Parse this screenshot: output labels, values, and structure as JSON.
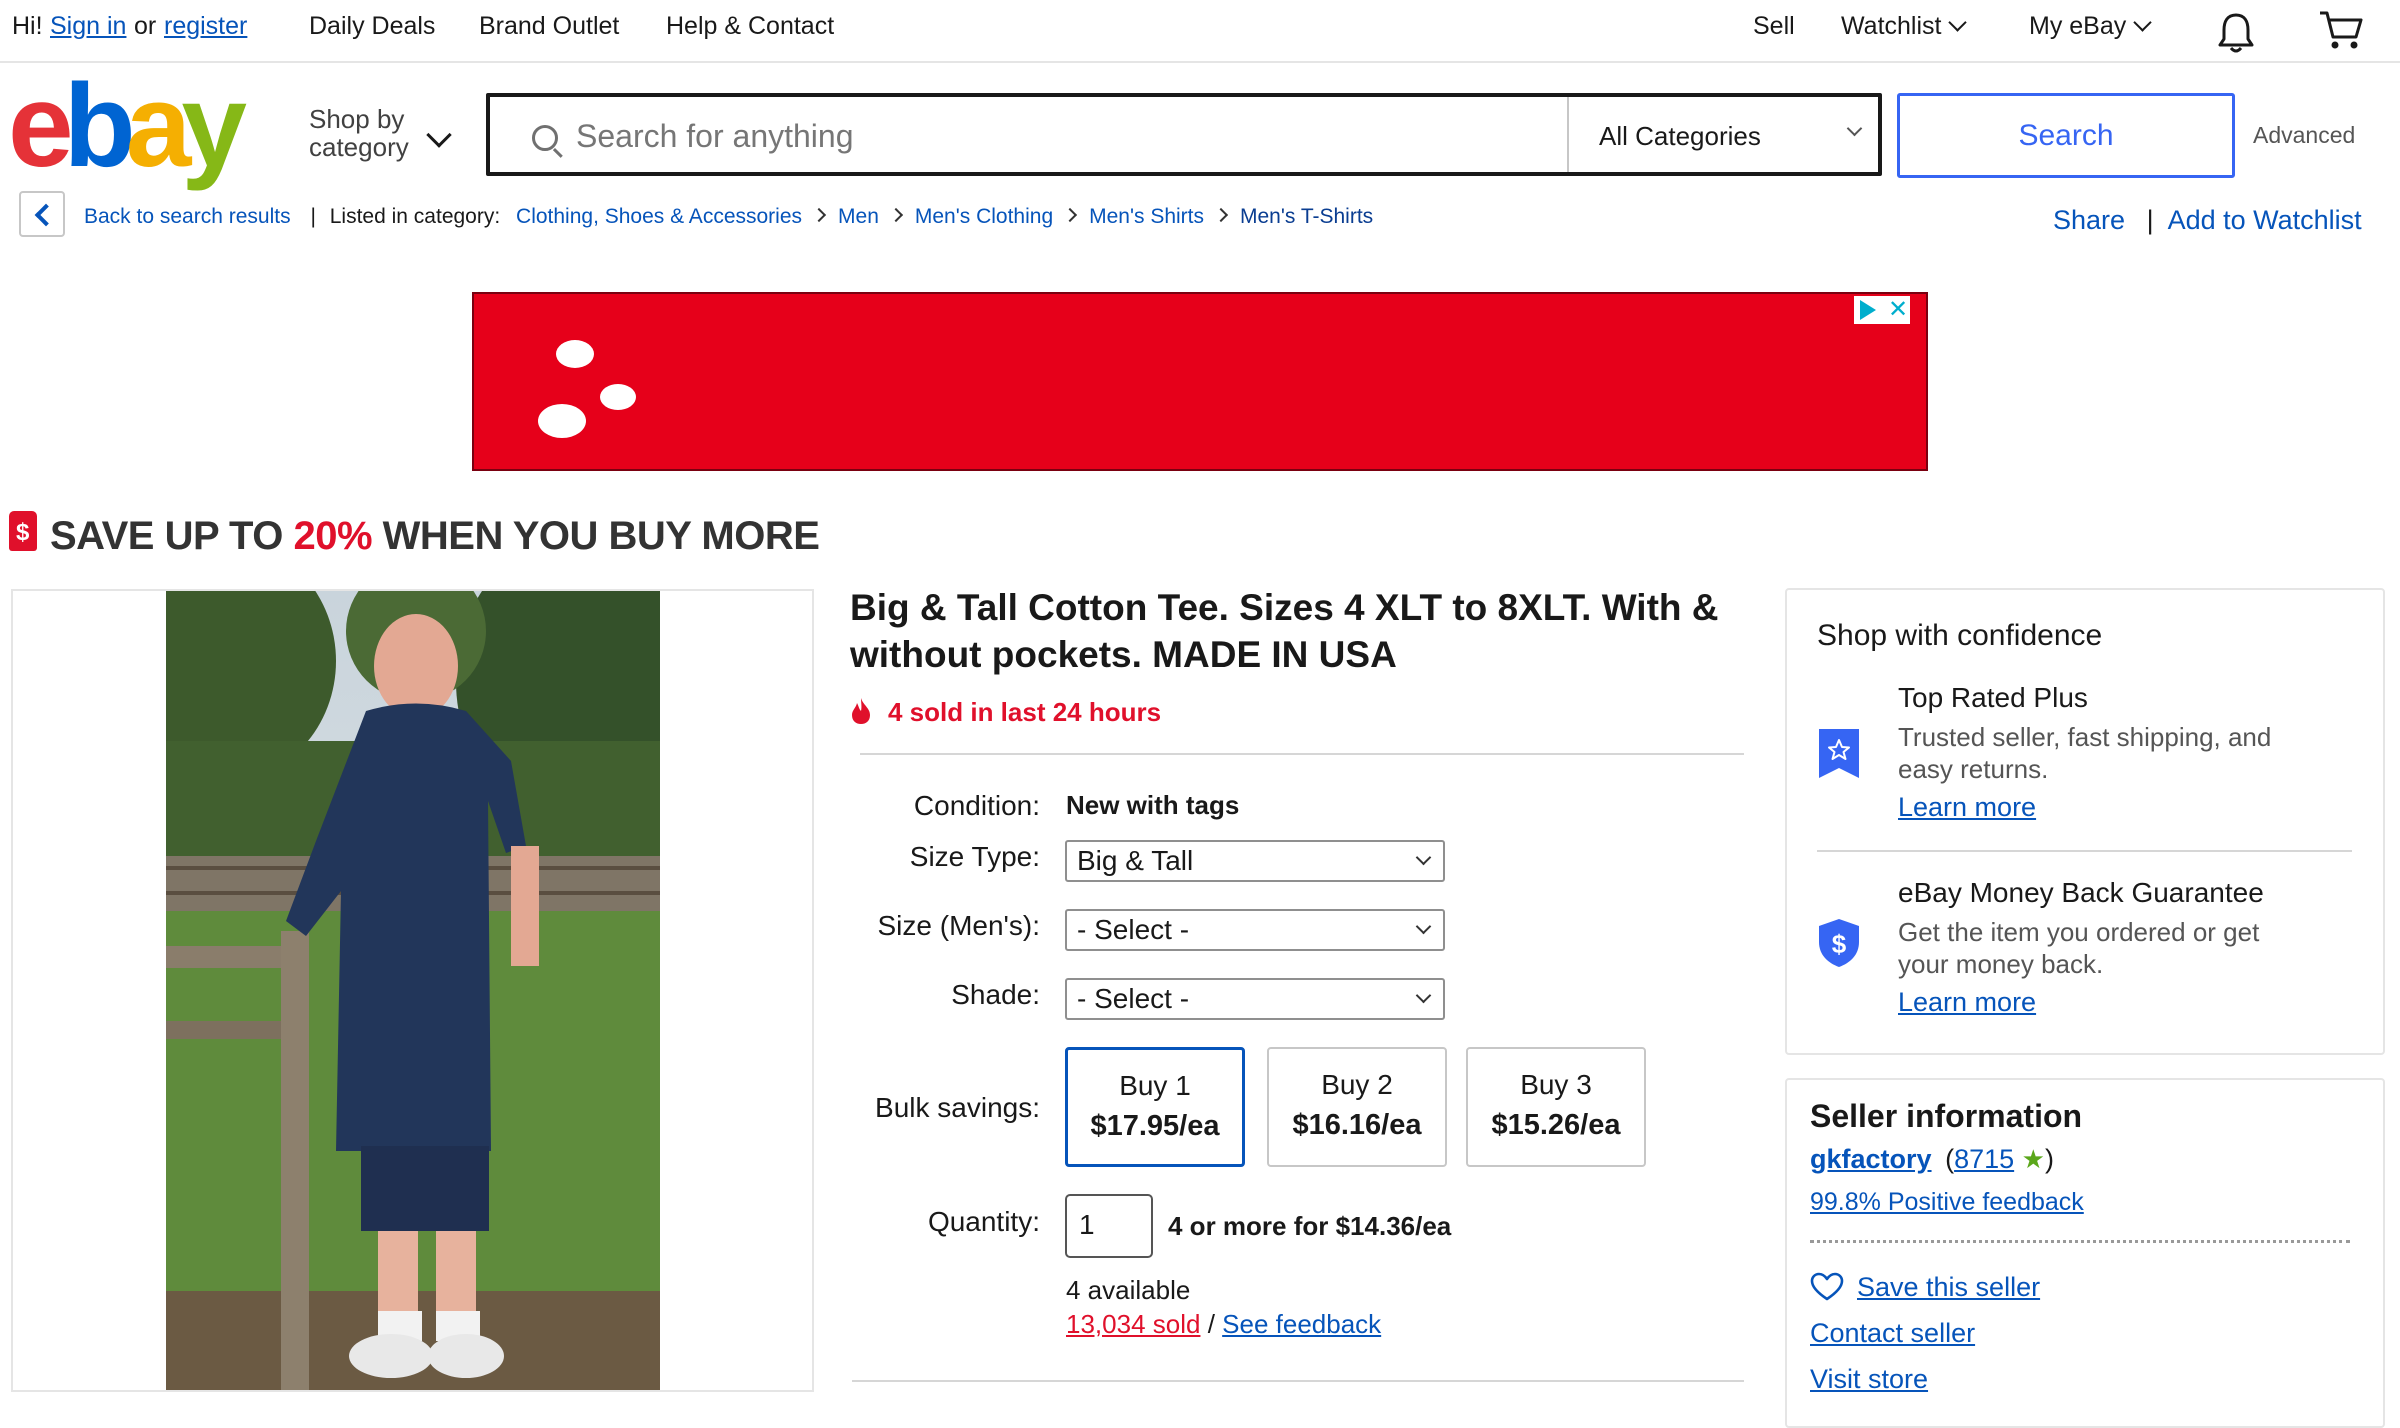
{
  "topbar": {
    "greeting": "Hi!",
    "sign_in": "Sign in",
    "or": "or",
    "register": "register",
    "daily_deals": "Daily Deals",
    "brand_outlet": "Brand Outlet",
    "help_contact": "Help & Contact",
    "sell": "Sell",
    "watchlist": "Watchlist",
    "my_ebay": "My eBay"
  },
  "header": {
    "logo_letters": [
      "e",
      "b",
      "a",
      "y"
    ],
    "logo_colors": [
      "#e53238",
      "#0064d2",
      "#f5af02",
      "#86b817"
    ],
    "shop_by_line1": "Shop by",
    "shop_by_line2": "category",
    "search_placeholder": "Search for anything",
    "category": "All Categories",
    "search_button": "Search",
    "advanced": "Advanced"
  },
  "breadcrumb": {
    "back": "Back to search results",
    "listed_in": "Listed in category:",
    "items": [
      "Clothing, Shoes & Accessories",
      "Men",
      "Men's Clothing",
      "Men's Shirts",
      "Men's T-Shirts"
    ],
    "share": "Share",
    "add_watchlist": "Add to Watchlist"
  },
  "promo": {
    "prefix": "SAVE UP TO ",
    "percent": "20%",
    "suffix": " WHEN YOU BUY MORE"
  },
  "product": {
    "title": "Big & Tall Cotton Tee. Sizes 4 XLT to 8XLT. With & without pockets. MADE IN USA",
    "sold_recent": "4 sold in last 24 hours",
    "condition_label": "Condition:",
    "condition_value": "New with tags",
    "size_type_label": "Size Type:",
    "size_type_value": "Big & Tall",
    "size_label": "Size (Men's):",
    "size_value": "- Select -",
    "shade_label": "Shade:",
    "shade_value": "- Select -",
    "bulk_label": "Bulk savings:",
    "bulk_options": [
      {
        "qty": "Buy 1",
        "price": "$17.95/ea"
      },
      {
        "qty": "Buy 2",
        "price": "$16.16/ea"
      },
      {
        "qty": "Buy 3",
        "price": "$15.26/ea"
      }
    ],
    "quantity_label": "Quantity:",
    "quantity_value": "1",
    "quantity_deal": "4 or more for $14.36/ea",
    "available": "4 available",
    "sold_total": "13,034 sold",
    "slash": "/",
    "see_feedback": "See feedback"
  },
  "confidence": {
    "title": "Shop with confidence",
    "trp_title": "Top Rated Plus",
    "trp_line1": "Trusted seller, fast shipping, and",
    "trp_line2": "easy returns.",
    "learn_more": "Learn more",
    "mbg_title": "eBay Money Back Guarantee",
    "mbg_line1": "Get the item you ordered or get",
    "mbg_line2": "your money back."
  },
  "seller": {
    "title": "Seller information",
    "name": "gkfactory",
    "open_paren": "(",
    "score": "8715",
    "close_paren": ")",
    "feedback": "99.8% Positive feedback",
    "save": "Save this seller",
    "contact": "Contact seller",
    "visit": "Visit store"
  }
}
